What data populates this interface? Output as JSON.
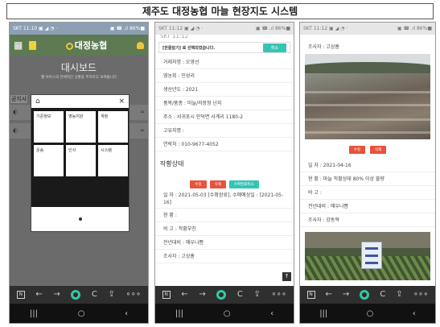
{
  "page_title": "제주도 대정농협 마늘 현장지도 시스템",
  "status_bar": {
    "left": "SKT 11:10 ▣ ◢ ◔ ·",
    "right": "▣ ☎ .ıl 86%■",
    "left_2": "SKT 11:12 ▣ ◢ ◔ ·",
    "right_2": "▣ ☎ .ıl 86%■",
    "left_3": "SKT 11:12 ▣ ◢ ◔ ·",
    "right_3": "▣ ☎ .ıl 86%■"
  },
  "phone1": {
    "app_name": "대정농협",
    "dashboard_title": "대시보드",
    "dashboard_sub": "웹 서비스의 전체적인 상황을 주차하고 보여줍니다",
    "side_label": "공지사",
    "modal_close": "×",
    "menu": [
      "기준정보",
      "영농지원",
      "계정",
      "운송",
      "인사",
      "시스템"
    ]
  },
  "phone2": {
    "ghost_text": "SKT 11:12",
    "alert_text": "[한줄달기] 로 선택되었습니다.",
    "cancel_label": "취소",
    "fields": [
      "거래처명 : 오영선",
      "영농회 : 인성리",
      "생산년도 : 2021",
      "품목/품종 : 마늘/저장형 난지",
      "주소 : 서귀포시 안덕면 사계리 1180-2",
      "고유지명 :",
      "연락처 : 010-9677-4052"
    ],
    "section_title": "작황상태",
    "buttons": [
      "수정",
      "삭제",
      "수확완료취소"
    ],
    "date_note": "일 자 : 2021-05-03 [수확완료], 수매예상일 : [2021-05-16]",
    "status_fields": [
      "현 황 :",
      "비 고 : 작황부진",
      "전년대비 : 매우나쁨",
      "조사자 : 고상흠"
    ],
    "scroll_top": "↑"
  },
  "phone3": {
    "investigator_top": "조사자 : 고상흠",
    "buttons": [
      "수정",
      "삭제"
    ],
    "fields": [
      "일 자 : 2021-04-16",
      "현 황 : 마늘 작황상태 80% 이상 불량",
      "비 고 :",
      "전년대비 : 매우나쁨",
      "조사자 : 강동혁"
    ]
  },
  "nav_bar": {
    "n": "N",
    "back": "←",
    "forward": "→",
    "reload": "C",
    "share": "⇪",
    "more": "∘∘∘"
  },
  "system_bar": {
    "recent": "|||",
    "home": "○",
    "back": "‹"
  },
  "icons": {
    "grid": "grid-icon",
    "home": "home-icon",
    "close": "close-icon",
    "user": "user-icon",
    "chevron": "chevron-icon"
  },
  "colors": {
    "app_header": "#5d7a52",
    "accent_teal": "#35c5b5",
    "accent_red": "#e8533c",
    "nav_bg": "#2f2f2f"
  }
}
